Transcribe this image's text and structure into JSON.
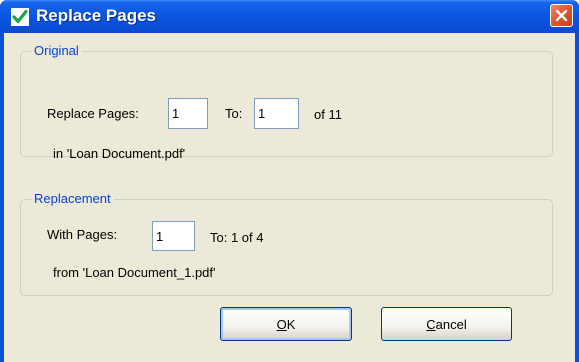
{
  "window": {
    "title": "Replace Pages",
    "title_icon": "green-checkmark-icon",
    "close_icon": "close-x-icon",
    "colors": {
      "titlebar": "#0a4fd8",
      "dialog_background": "#ece9d8",
      "group_label": "#0046d5",
      "close_button": "#e4572e",
      "checkmark": "#1fa345"
    }
  },
  "original": {
    "legend": "Original",
    "replace_pages_label": "Replace Pages:",
    "from_value": "1",
    "to_label": "To:",
    "to_value": "1",
    "of_text": "of 11",
    "in_text": "in  'Loan Document.pdf'"
  },
  "replacement": {
    "legend": "Replacement",
    "with_pages_label": "With Pages:",
    "from_value": "1",
    "to_text": "To:  1  of 4",
    "from_text": "from  'Loan Document_1.pdf'"
  },
  "buttons": {
    "ok_first": "O",
    "ok_rest": "K",
    "cancel_first": "C",
    "cancel_rest": "ancel"
  }
}
